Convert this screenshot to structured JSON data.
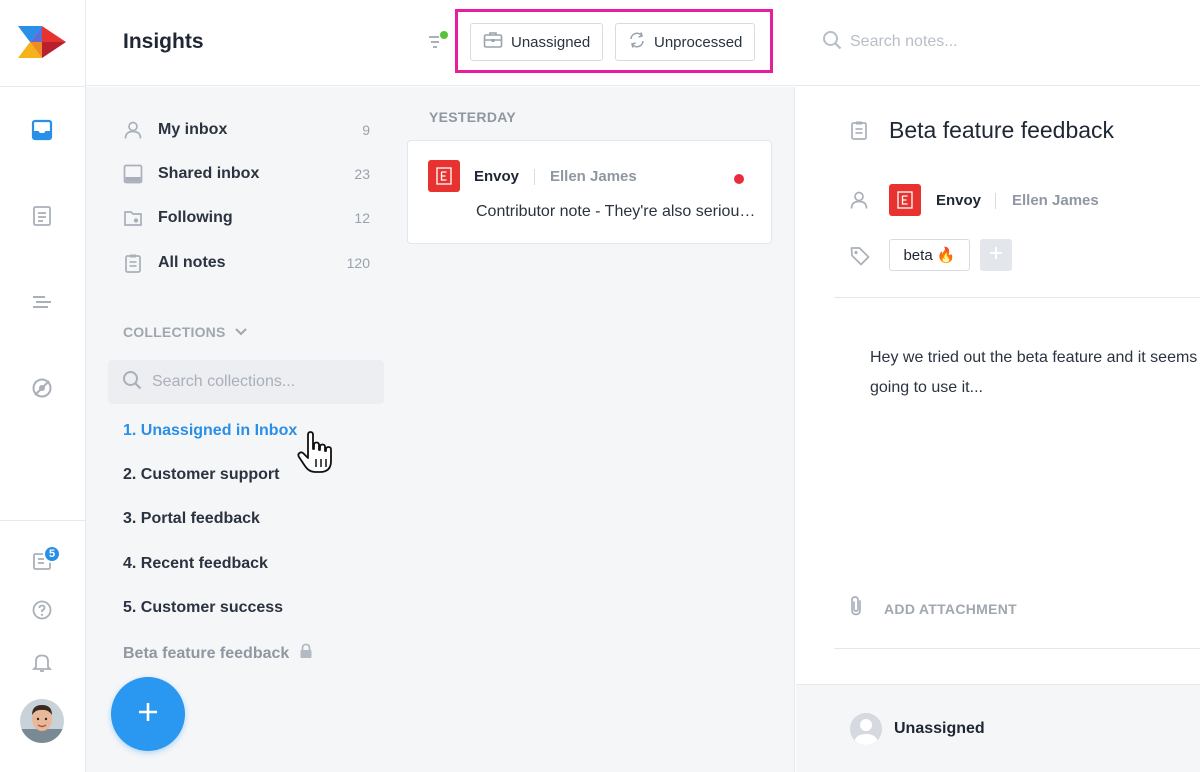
{
  "header": {
    "title": "Insights",
    "filters": [
      {
        "label": "Unassigned",
        "icon": "briefcase-icon"
      },
      {
        "label": "Unprocessed",
        "icon": "refresh-icon"
      }
    ],
    "search_placeholder": "Search notes..."
  },
  "rail": {
    "icons": [
      "inbox-icon",
      "notes-icon",
      "list-icon",
      "insights-icon"
    ],
    "bottom_icons": [
      "changelog-icon",
      "help-icon",
      "bell-icon"
    ],
    "badge_count": "5",
    "accent": "#2a8fe6"
  },
  "nav": {
    "items": [
      {
        "label": "My inbox",
        "count": "9",
        "icon": "user-icon"
      },
      {
        "label": "Shared inbox",
        "count": "23",
        "icon": "inbox-icon"
      },
      {
        "label": "Following",
        "count": "12",
        "icon": "following-icon"
      },
      {
        "label": "All notes",
        "count": "120",
        "icon": "clipboard-icon"
      }
    ],
    "collections_heading": "COLLECTIONS",
    "collections_search_placeholder": "Search collections...",
    "collections": [
      {
        "label": "1. Unassigned in Inbox",
        "active": true
      },
      {
        "label": "2. Customer support"
      },
      {
        "label": "3. Portal feedback"
      },
      {
        "label": "4. Recent feedback"
      },
      {
        "label": "5. Customer success"
      },
      {
        "label": "Beta feature feedback",
        "locked": true
      }
    ]
  },
  "list": {
    "group_label": "YESTERDAY",
    "notes": [
      {
        "company": "Envoy",
        "person": "Ellen James",
        "excerpt": "Contributor note - They're also serious about this",
        "unread": true
      }
    ]
  },
  "detail": {
    "title": "Beta feature feedback",
    "company": "Envoy",
    "person": "Ellen James",
    "tag": "beta 🔥",
    "body_line1": "Hey we tried out the beta feature and it seems great, we are",
    "body_line2": "going to use it...",
    "attachment_label": "ADD ATTACHMENT",
    "assignee": "Unassigned"
  },
  "colors": {
    "brand_red": "#e8322f",
    "highlight": "#e61ea0",
    "fab": "#2a97f0",
    "unread": "#ea2d3c",
    "filter_dot": "#57c23a"
  }
}
